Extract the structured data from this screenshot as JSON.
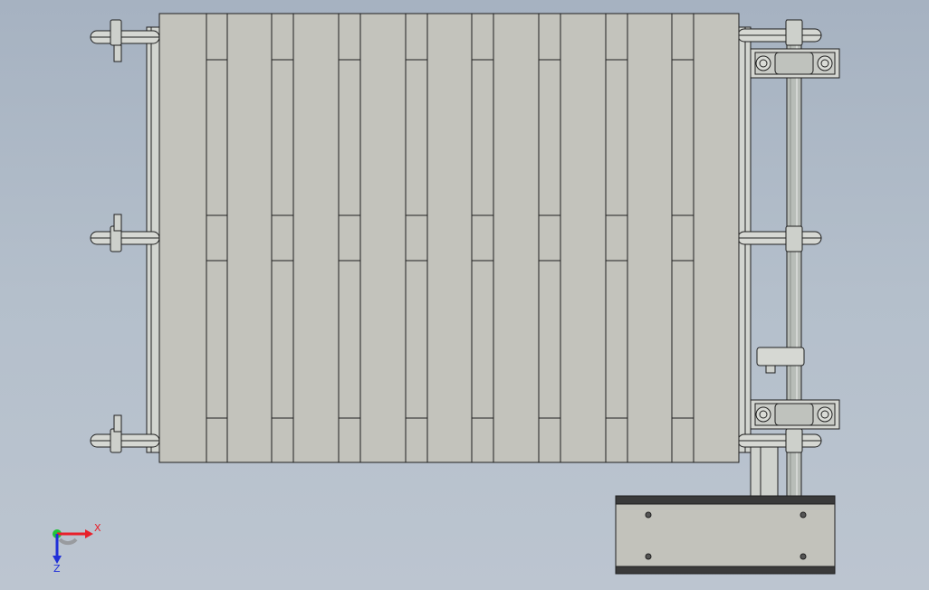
{
  "viewport": {
    "background_top": "#a6b2c1",
    "background_bottom": "#bcc5d0"
  },
  "model": {
    "plate_color": "#c3c3bc",
    "line_color": "#1f1f1f",
    "metal_color": "#d3d6d2",
    "shaft_color": "#b8bdb8",
    "motor_color": "#c2c2bb",
    "motor_band_color": "#3a3a3a"
  },
  "triad": {
    "x_label": "X",
    "z_label": "Z",
    "x_color": "#e8202a",
    "y_color": "#22c43a",
    "z_color": "#2030d8",
    "x_icon": "x-axis-arrow-icon",
    "y_icon": "y-axis-arrow-icon",
    "z_icon": "z-axis-arrow-icon"
  }
}
